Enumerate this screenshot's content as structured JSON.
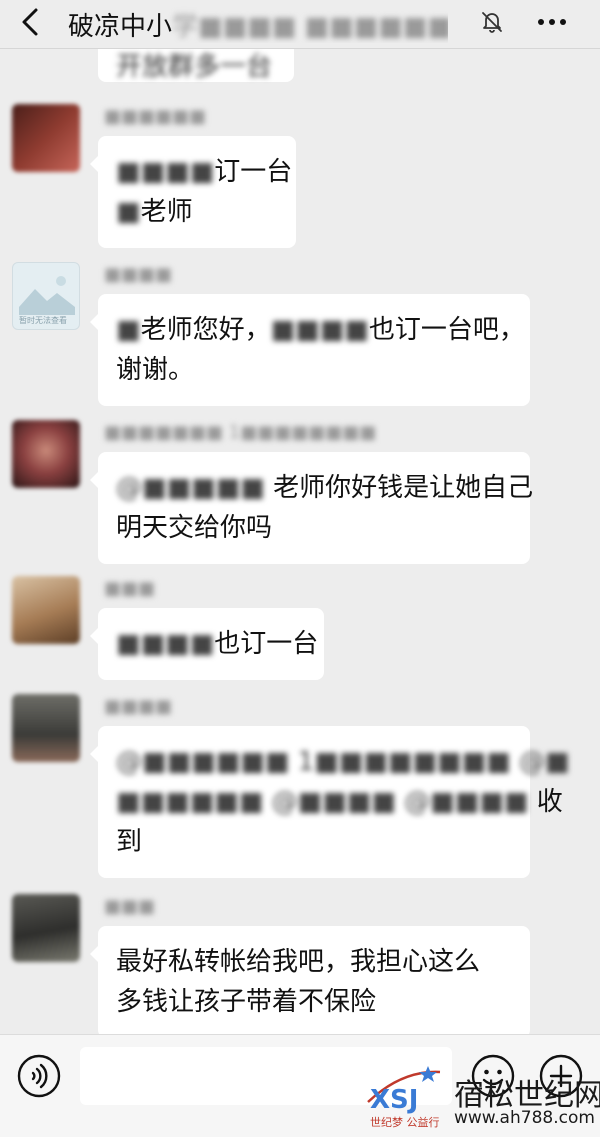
{
  "header": {
    "title_visible": "破凉中小",
    "title_hidden": "学■■■■ ■■■■■■(■■)",
    "back_icon": "chevron-left-icon",
    "mute_icon": "bell-off-icon",
    "more_icon": "ellipsis-icon"
  },
  "partial_message": {
    "text": "开放群多一台"
  },
  "messages": [
    {
      "sender": "■■■■■■",
      "avatar_colors": [
        "#5a2a22",
        "#a8493c"
      ],
      "lines": [
        {
          "hidden": "■■■■",
          "visible": "订一台"
        },
        {
          "hidden": "■",
          "visible": "老师"
        }
      ]
    },
    {
      "sender": "■■■■",
      "avatar_caption": "暂时无法查看",
      "lines": [
        {
          "hidden": "■",
          "visible": "老师您好，",
          "hidden2": "■■■■",
          "visible2": "也订一台吧，"
        },
        {
          "visible": "谢谢。"
        }
      ]
    },
    {
      "sender": "■■■■■■■ 1■■■■■■■■",
      "avatar_colors": [
        "#3b1f1f",
        "#c96a60"
      ],
      "lines": [
        {
          "hidden": "@■■■■■",
          "visible": " 老师你好钱是让她自己"
        },
        {
          "visible": "明天交给你吗"
        }
      ]
    },
    {
      "sender": "■■■",
      "avatar_colors": [
        "#8a6a4a",
        "#d8b48a"
      ],
      "lines": [
        {
          "hidden": "■■■■",
          "visible": "也订一台"
        }
      ]
    },
    {
      "sender": "■■■■",
      "avatar_colors": [
        "#4a4a48",
        "#8a8a86"
      ],
      "lines": [
        {
          "hidden": "@■■■■■■ 1■■■■■■■■ @■"
        },
        {
          "hidden": "■■■■■■ @■■■■ @■■■■",
          "visible": " 收"
        },
        {
          "visible": "到"
        }
      ]
    },
    {
      "sender": "■■■",
      "avatar_colors": [
        "#3d3d3a",
        "#7a7a70"
      ],
      "lines": [
        {
          "visible": "最好私转帐给我吧，我担心这么"
        },
        {
          "visible": "多钱让孩子带着不保险"
        }
      ]
    }
  ],
  "composer": {
    "input_value": "",
    "voice_icon": "voice-icon",
    "emoji_icon": "emoji-icon",
    "plus_icon": "plus-icon"
  },
  "watermark": {
    "logo_text": "XSJ",
    "subtitle": "世纪梦 公益行",
    "name": "宿松世纪网",
    "url": "www.ah788.com"
  }
}
